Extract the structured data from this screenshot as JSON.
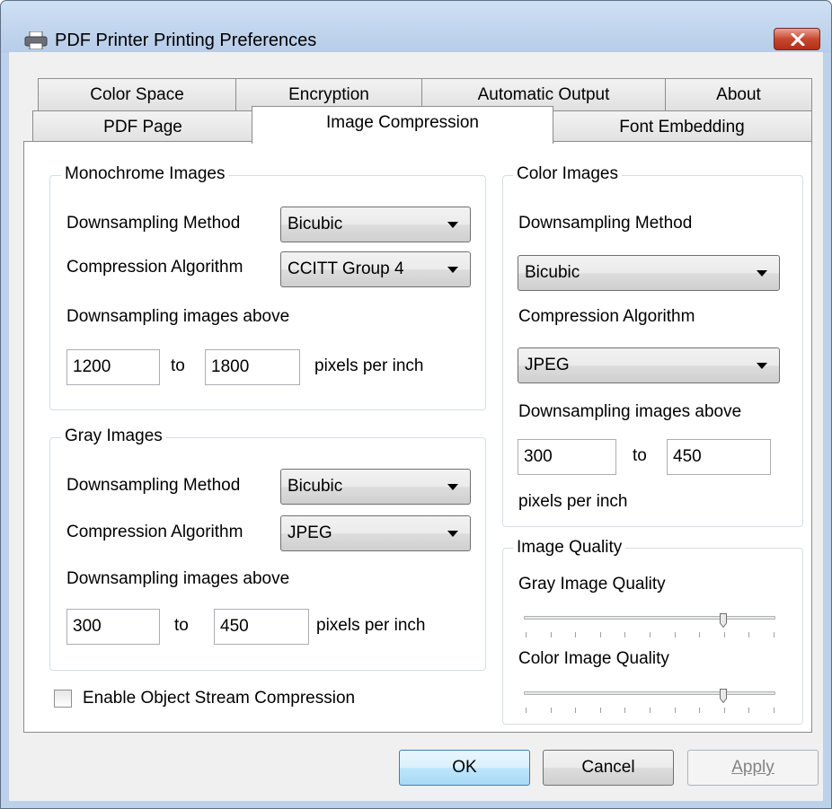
{
  "window": {
    "title": "PDF Printer Printing Preferences"
  },
  "tabs": {
    "row_back": [
      "Color Space",
      "Encryption",
      "Automatic Output",
      "About"
    ],
    "row_front": [
      "PDF Page",
      "Image Compression",
      "Font Embedding"
    ],
    "active": "Image Compression"
  },
  "monochrome": {
    "title": "Monochrome Images",
    "downsampling_method_label": "Downsampling Method",
    "downsampling_method_value": "Bicubic",
    "compression_label": "Compression Algorithm",
    "compression_value": "CCITT Group 4",
    "downsampling_above_label": "Downsampling images above",
    "from_value": "1200",
    "to_label": "to",
    "to_value": "1800",
    "ppi_label": "pixels per inch"
  },
  "gray": {
    "title": "Gray Images",
    "downsampling_method_label": "Downsampling Method",
    "downsampling_method_value": "Bicubic",
    "compression_label": "Compression Algorithm",
    "compression_value": "JPEG",
    "downsampling_above_label": "Downsampling images above",
    "from_value": "300",
    "to_label": "to",
    "to_value": "450",
    "ppi_label": "pixels per inch"
  },
  "color": {
    "title": "Color Images",
    "downsampling_method_label": "Downsampling Method",
    "downsampling_method_value": "Bicubic",
    "compression_label": "Compression Algorithm",
    "compression_value": "JPEG",
    "downsampling_above_label": "Downsampling images above",
    "from_value": "300",
    "to_label": "to",
    "to_value": "450",
    "ppi_label": "pixels per inch"
  },
  "quality": {
    "title": "Image Quality",
    "gray_label": "Gray Image Quality",
    "gray_level": 0.8,
    "color_label": "Color Image Quality",
    "color_level": 0.8
  },
  "object_stream": {
    "label": "Enable Object Stream Compression",
    "checked": false
  },
  "buttons": {
    "ok": "OK",
    "cancel": "Cancel",
    "apply": "Apply"
  },
  "colors": {
    "titlebar": "#b9d1ea",
    "close": "#c7472f",
    "default_button": "#3c7fb1"
  }
}
